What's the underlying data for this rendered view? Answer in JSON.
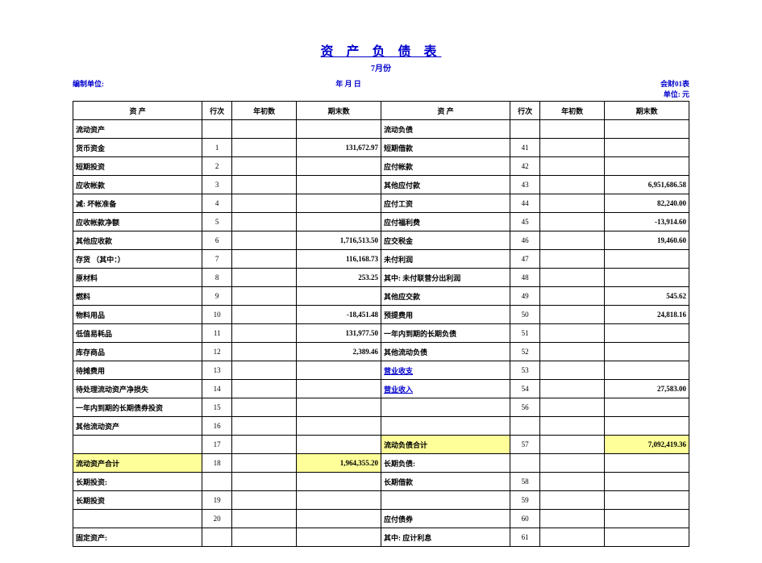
{
  "title": "资 产 负 债 表",
  "subtitle": "7月份",
  "meta": {
    "left": "编制单位:",
    "center": "年   月   日",
    "right1": "会财01表",
    "right2": "单位: 元"
  },
  "headers": {
    "asset": "资   产",
    "row": "行次",
    "begin": "年初数",
    "end": "期末数",
    "liab": "资   产"
  },
  "rows": [
    {
      "a": {
        "t": "流动资产",
        "c": "lbl"
      },
      "ar": "",
      "ab": "",
      "ae": "",
      "l": {
        "t": "流动负债",
        "c": "lbl"
      },
      "lr": "",
      "lb": "",
      "le": ""
    },
    {
      "a": {
        "t": "货币资金",
        "c": "lbl1"
      },
      "ar": "1",
      "ab": "",
      "ae": "131,672.97",
      "l": {
        "t": "短期借款",
        "c": "lbl1"
      },
      "lr": "41",
      "lb": "",
      "le": ""
    },
    {
      "a": {
        "t": "短期投资",
        "c": "lbl1"
      },
      "ar": "2",
      "ab": "",
      "ae": "",
      "l": {
        "t": "应付帐款",
        "c": "lbl1"
      },
      "lr": "42",
      "lb": "",
      "le": ""
    },
    {
      "a": {
        "t": "应收帐款",
        "c": "lbl1"
      },
      "ar": "3",
      "ab": "",
      "ae": "",
      "l": {
        "t": "其他应付款",
        "c": "lbl1"
      },
      "lr": "43",
      "lb": "",
      "le": "6,951,686.58"
    },
    {
      "a": {
        "t": "减: 坏帐准备",
        "c": "lbl2"
      },
      "ar": "4",
      "ab": "",
      "ae": "",
      "l": {
        "t": "应付工资",
        "c": "lbl1"
      },
      "lr": "44",
      "lb": "",
      "le": "82,240.00"
    },
    {
      "a": {
        "t": "应收帐款净额",
        "c": "lbl1"
      },
      "ar": "5",
      "ab": "",
      "ae": "",
      "l": {
        "t": "应付福利费",
        "c": "lbl1"
      },
      "lr": "45",
      "lb": "",
      "le": "-13,914.60"
    },
    {
      "a": {
        "t": "其他应收款",
        "c": "lbl1"
      },
      "ar": "6",
      "ab": "",
      "ae": "1,716,513.50",
      "l": {
        "t": "应交税金",
        "c": "lbl1"
      },
      "lr": "46",
      "lb": "",
      "le": "19,460.60"
    },
    {
      "a": {
        "t": "存货 （其中：）",
        "c": "lbl1"
      },
      "ar": "7",
      "ab": "",
      "ae": "116,168.73",
      "l": {
        "t": "未付利润",
        "c": "lbl1"
      },
      "lr": "47",
      "lb": "",
      "le": ""
    },
    {
      "a": {
        "t": "原材料",
        "c": "lbl3"
      },
      "ar": "8",
      "ab": "",
      "ae": "253.25",
      "l": {
        "t": "其中: 未付联营分出利润",
        "c": "lbl2"
      },
      "lr": "48",
      "lb": "",
      "le": ""
    },
    {
      "a": {
        "t": "燃料",
        "c": "lbl3"
      },
      "ar": "9",
      "ab": "",
      "ae": "",
      "l": {
        "t": "其他应交款",
        "c": "lbl1"
      },
      "lr": "49",
      "lb": "",
      "le": "545.62"
    },
    {
      "a": {
        "t": "物料用品",
        "c": "lbl3"
      },
      "ar": "10",
      "ab": "",
      "ae": "-18,451.48",
      "l": {
        "t": "预提费用",
        "c": "lbl1"
      },
      "lr": "50",
      "lb": "",
      "le": "24,818.16"
    },
    {
      "a": {
        "t": "低值易耗品",
        "c": "lbl3"
      },
      "ar": "11",
      "ab": "",
      "ae": "131,977.50",
      "l": {
        "t": "一年内到期的长期负债",
        "c": "lbl1"
      },
      "lr": "51",
      "lb": "",
      "le": ""
    },
    {
      "a": {
        "t": "库存商品",
        "c": "lbl3"
      },
      "ar": "12",
      "ab": "",
      "ae": "2,389.46",
      "l": {
        "t": "其他流动负债",
        "c": "lbl1"
      },
      "lr": "52",
      "lb": "",
      "le": ""
    },
    {
      "a": {
        "t": "待摊费用",
        "c": "lbl1"
      },
      "ar": "13",
      "ab": "",
      "ae": "",
      "l": {
        "t": "营业收支",
        "c": "lbl1 link"
      },
      "lr": "53",
      "lb": "",
      "le": ""
    },
    {
      "a": {
        "t": "待处理流动资产净损失",
        "c": "lbl1"
      },
      "ar": "14",
      "ab": "",
      "ae": "",
      "l": {
        "t": "营业收入",
        "c": "lbl1 link"
      },
      "lr": "54",
      "lb": "",
      "le": "27,583.00"
    },
    {
      "a": {
        "t": "一年内到期的长期债券投资",
        "c": "lbl1"
      },
      "ar": "15",
      "ab": "",
      "ae": "",
      "l": {
        "t": "",
        "c": "lbl1"
      },
      "lr": "56",
      "lb": "",
      "le": ""
    },
    {
      "a": {
        "t": "其他流动资产",
        "c": "lbl1"
      },
      "ar": "16",
      "ab": "",
      "ae": "",
      "l": {
        "t": "",
        "c": "lbl1"
      },
      "lr": "",
      "lb": "",
      "le": ""
    },
    {
      "a": {
        "t": "",
        "c": "lbl1"
      },
      "ar": "17",
      "ab": "",
      "ae": "",
      "l": {
        "t": "流动负债合计",
        "c": "lbl1",
        "hl": true
      },
      "lr": "57",
      "lb": "",
      "le": "7,092,419.36",
      "lehl": true
    },
    {
      "a": {
        "t": "流动资产合计",
        "c": "lbl1",
        "hl": true
      },
      "ar": "18",
      "ab": "",
      "ae": "1,964,355.20",
      "aehl": true,
      "l": {
        "t": "长期负债:",
        "c": "lbl"
      },
      "lr": "",
      "lb": "",
      "le": ""
    },
    {
      "a": {
        "t": "长期投资:",
        "c": "lbl"
      },
      "ar": "",
      "ab": "",
      "ae": "",
      "l": {
        "t": "长期借款",
        "c": "lbl1"
      },
      "lr": "58",
      "lb": "",
      "le": ""
    },
    {
      "a": {
        "t": "长期投资",
        "c": "lbl1"
      },
      "ar": "19",
      "ab": "",
      "ae": "",
      "l": {
        "t": "",
        "c": "lbl1"
      },
      "lr": "59",
      "lb": "",
      "le": ""
    },
    {
      "a": {
        "t": "",
        "c": "lbl1"
      },
      "ar": "20",
      "ab": "",
      "ae": "",
      "l": {
        "t": "应付债券",
        "c": "lbl1"
      },
      "lr": "60",
      "lb": "",
      "le": ""
    },
    {
      "a": {
        "t": "固定资产:",
        "c": "lbl"
      },
      "ar": "",
      "ab": "",
      "ae": "",
      "l": {
        "t": "其中: 应计利息",
        "c": "lbl2"
      },
      "lr": "61",
      "lb": "",
      "le": ""
    }
  ]
}
